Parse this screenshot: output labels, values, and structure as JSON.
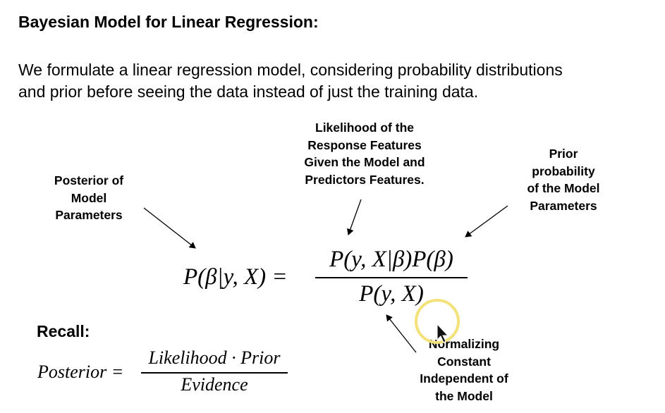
{
  "title": "Bayesian Model for Linear Regression:",
  "intro": {
    "line1": "We formulate a linear regression model, considering probability distributions",
    "line2": "and prior before seeing the data instead of just the training data."
  },
  "annotations": {
    "posterior": [
      "Posterior of",
      "Model",
      "Parameters"
    ],
    "likelihood": [
      "Likelihood of the",
      "Response Features",
      "Given the Model and",
      "Predictors Features."
    ],
    "prior": [
      "Prior",
      "probability",
      "of the Model",
      "Parameters"
    ],
    "normalizing": [
      "Normalizing",
      "Constant",
      "Independent of",
      "the Model"
    ]
  },
  "equation": {
    "lhs": "P(β|y, X) =",
    "numerator": "P(y, X|β)P(β)",
    "denominator": "P(y, X)"
  },
  "recall": {
    "heading": "Recall:",
    "lhs": "Posterior =",
    "numerator": "Likelihood · Prior",
    "denominator": "Evidence"
  },
  "colors": {
    "cursor_highlight": "#f3e27a",
    "arrow": "#000000"
  },
  "icons": [
    "mouse-cursor-icon"
  ]
}
